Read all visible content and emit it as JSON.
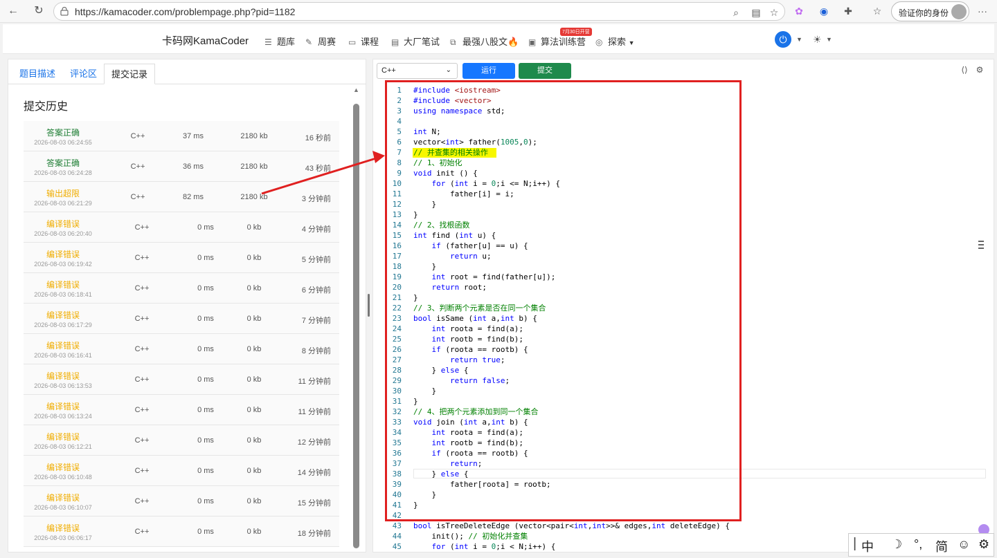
{
  "browser": {
    "url": "https://kamacoder.com/problempage.php?pid=1182",
    "verify_label": "验证你的身份",
    "more_label": "···"
  },
  "header": {
    "brand": "卡码网KamaCoder",
    "nav": [
      {
        "label": "题库",
        "icon": "list-icon"
      },
      {
        "label": "周赛",
        "icon": "pen-icon"
      },
      {
        "label": "课程",
        "icon": "book-icon"
      },
      {
        "label": "大厂笔试",
        "icon": "doc-icon"
      },
      {
        "label": "最强八股文🔥",
        "icon": "code-icon"
      },
      {
        "label": "算法训练营",
        "icon": "calendar-icon"
      },
      {
        "label": "探索",
        "icon": "compass-icon"
      }
    ],
    "badge": "7月30日开营"
  },
  "left": {
    "tabs": [
      "题目描述",
      "评论区",
      "提交记录"
    ],
    "active_tab": "提交记录",
    "heading": "提交历史",
    "rows": [
      {
        "status": "答案正确",
        "kind": "ok",
        "date": "2026-08-03 06:24:55",
        "lang": "C++",
        "time": "37 ms",
        "mem": "2180 kb",
        "ago": "16 秒前"
      },
      {
        "status": "答案正确",
        "kind": "ok",
        "date": "2026-08-03 06:24:28",
        "lang": "C++",
        "time": "36 ms",
        "mem": "2180 kb",
        "ago": "43 秒前"
      },
      {
        "status": "输出超限",
        "kind": "warn",
        "date": "2026-08-03 06:21:29",
        "lang": "C++",
        "time": "82 ms",
        "mem": "2180 kb",
        "ago": "3 分钟前"
      },
      {
        "status": "编译错误",
        "kind": "warn",
        "date": "2026-08-03 06:20:40",
        "lang": "C++",
        "time": "0 ms",
        "mem": "0 kb",
        "ago": "4 分钟前"
      },
      {
        "status": "编译错误",
        "kind": "warn",
        "date": "2026-08-03 06:19:42",
        "lang": "C++",
        "time": "0 ms",
        "mem": "0 kb",
        "ago": "5 分钟前"
      },
      {
        "status": "编译错误",
        "kind": "warn",
        "date": "2026-08-03 06:18:41",
        "lang": "C++",
        "time": "0 ms",
        "mem": "0 kb",
        "ago": "6 分钟前"
      },
      {
        "status": "编译错误",
        "kind": "warn",
        "date": "2026-08-03 06:17:29",
        "lang": "C++",
        "time": "0 ms",
        "mem": "0 kb",
        "ago": "7 分钟前"
      },
      {
        "status": "编译错误",
        "kind": "warn",
        "date": "2026-08-03 06:16:41",
        "lang": "C++",
        "time": "0 ms",
        "mem": "0 kb",
        "ago": "8 分钟前"
      },
      {
        "status": "编译错误",
        "kind": "warn",
        "date": "2026-08-03 06:13:53",
        "lang": "C++",
        "time": "0 ms",
        "mem": "0 kb",
        "ago": "11 分钟前"
      },
      {
        "status": "编译错误",
        "kind": "warn",
        "date": "2026-08-03 06:13:24",
        "lang": "C++",
        "time": "0 ms",
        "mem": "0 kb",
        "ago": "11 分钟前"
      },
      {
        "status": "编译错误",
        "kind": "warn",
        "date": "2026-08-03 06:12:21",
        "lang": "C++",
        "time": "0 ms",
        "mem": "0 kb",
        "ago": "12 分钟前"
      },
      {
        "status": "编译错误",
        "kind": "warn",
        "date": "2026-08-03 06:10:48",
        "lang": "C++",
        "time": "0 ms",
        "mem": "0 kb",
        "ago": "14 分钟前"
      },
      {
        "status": "编译错误",
        "kind": "warn",
        "date": "2026-08-03 06:10:07",
        "lang": "C++",
        "time": "0 ms",
        "mem": "0 kb",
        "ago": "15 分钟前"
      },
      {
        "status": "编译错误",
        "kind": "warn",
        "date": "2026-08-03 06:06:17",
        "lang": "C++",
        "time": "0 ms",
        "mem": "0 kb",
        "ago": "18 分钟前"
      }
    ]
  },
  "editor": {
    "language": "C++",
    "run_label": "运行",
    "submit_label": "提交",
    "lines": [
      "#include <iostream>",
      "#include <vector>",
      "using namespace std;",
      "",
      "int N;",
      "vector<int> father(1005,0);",
      "// 并查集的相关操作",
      "// 1、初始化",
      "void init () {",
      "    for (int i = 0;i <= N;i++) {",
      "        father[i] = i;",
      "    }",
      "}",
      "// 2、找根函数",
      "int find (int u) {",
      "    if (father[u] == u) {",
      "        return u;",
      "    }",
      "    int root = find(father[u]);",
      "    return root;",
      "}",
      "// 3、判断两个元素是否在同一个集合",
      "bool isSame (int a,int b) {",
      "    int roota = find(a);",
      "    int rootb = find(b);",
      "    if (roota == rootb) {",
      "        return true;",
      "    } else {",
      "        return false;",
      "    }",
      "}",
      "// 4、把两个元素添加到同一个集合",
      "void join (int a,int b) {",
      "    int roota = find(a);",
      "    int rootb = find(b);",
      "    if (roota == rootb) {",
      "        return;",
      "    } else {",
      "        father[roota] = rootb;",
      "    }",
      "}",
      "",
      "bool isTreeDeleteEdge (vector<pair<int,int>>& edges,int deleteEdge) {",
      "    init(); // 初始化并查集",
      "    for (int i = 0;i < N;i++) {"
    ]
  },
  "ime": [
    "中",
    "☽",
    "°,",
    "简",
    "☺",
    "⚙"
  ],
  "colors": {
    "accent": "#1677ff",
    "submit": "#1e8a4c",
    "ok": "#1e7e34",
    "warn": "#f0ad00",
    "annotation": "#e02020"
  }
}
